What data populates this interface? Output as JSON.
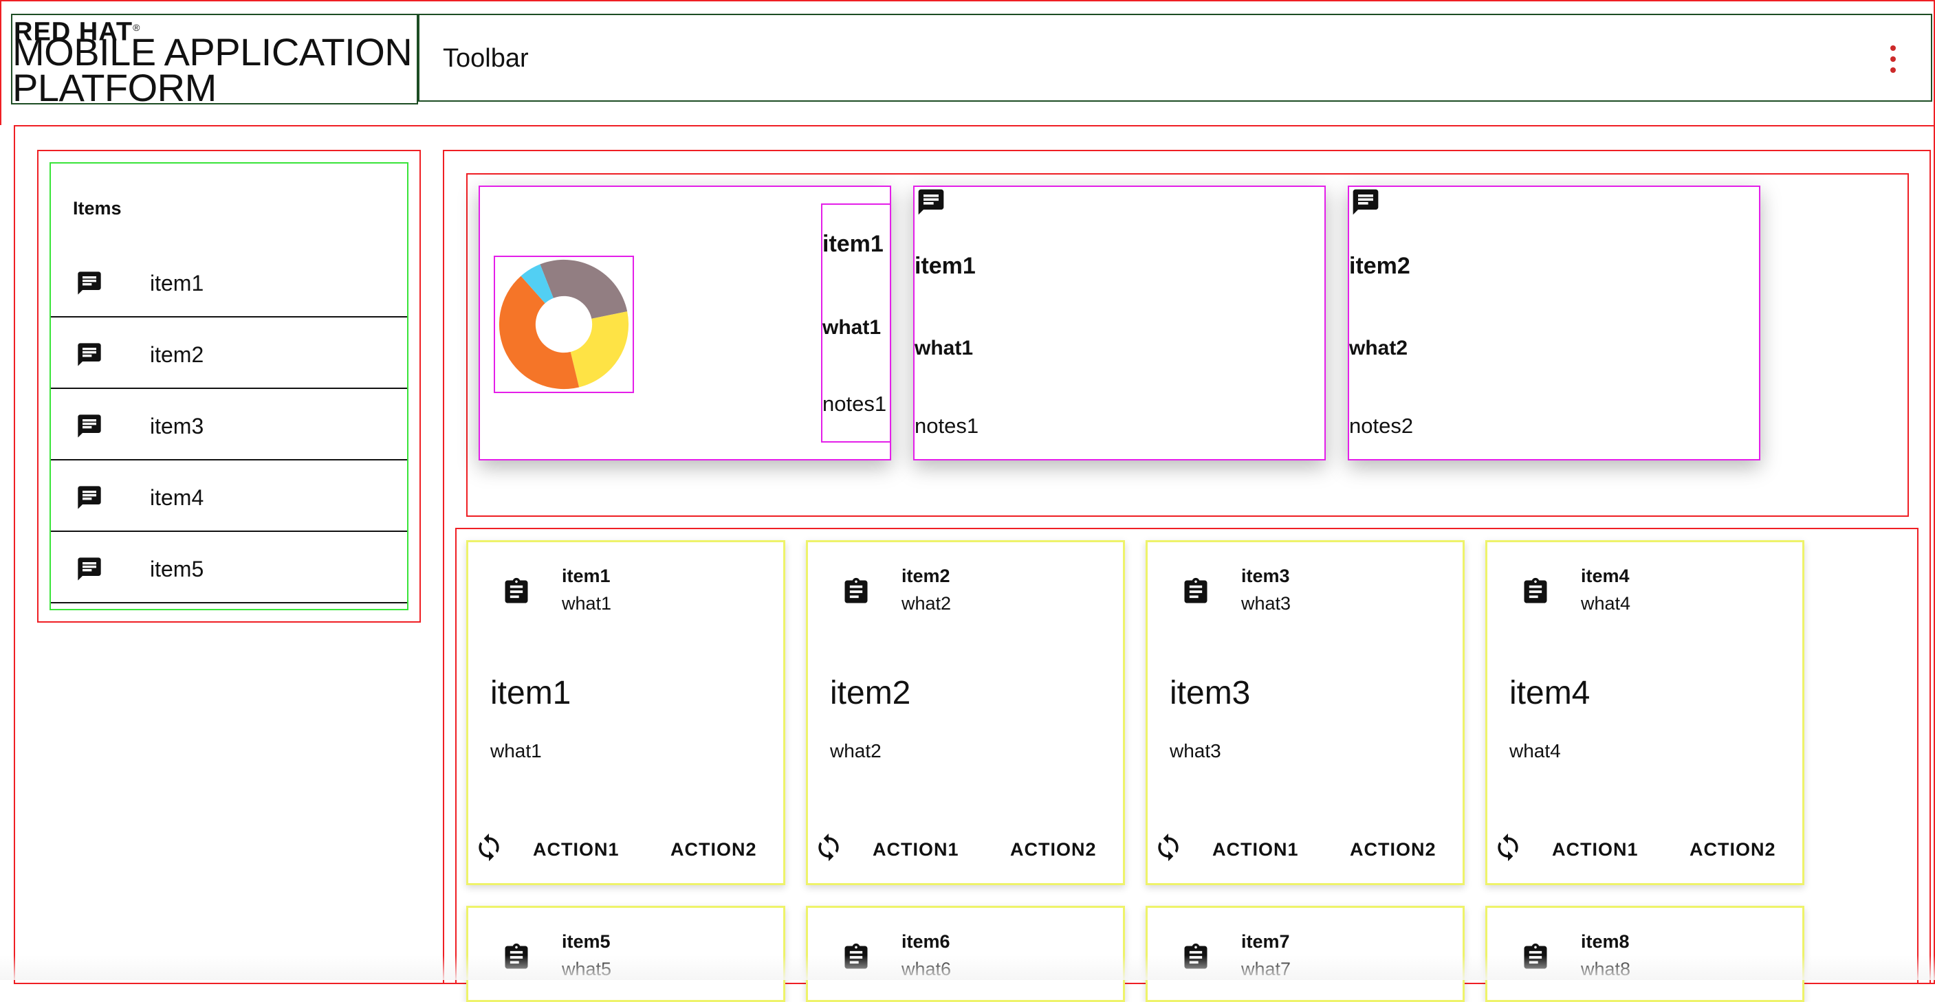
{
  "header": {
    "brand_small": "RED HAT",
    "brand_registered": "®",
    "brand_line1": "MOBILE APPLICATION",
    "brand_line2": "PLATFORM",
    "toolbar_title": "Toolbar",
    "kebab_icon": "more-vert-icon",
    "accent_color": "#cc2a2a"
  },
  "sidebar": {
    "heading": "Items",
    "item_icon": "message-icon",
    "items": [
      {
        "label": "item1"
      },
      {
        "label": "item2"
      },
      {
        "label": "item3"
      },
      {
        "label": "item4"
      },
      {
        "label": "item5"
      }
    ]
  },
  "chart_card": {
    "title": "item1",
    "what": "what1",
    "notes": "notes1"
  },
  "chart_data": {
    "type": "pie",
    "donut": true,
    "title": "",
    "categories": [
      "",
      "",
      "",
      ""
    ],
    "values": [
      25,
      22,
      38,
      5
    ],
    "colors": [
      "#927e82",
      "#fee345",
      "#f57528",
      "#52cff3"
    ]
  },
  "message_cards": [
    {
      "title": "item1",
      "what": "what1",
      "notes": "notes1",
      "icon": "message-icon"
    },
    {
      "title": "item2",
      "what": "what2",
      "notes": "notes2",
      "icon": "message-icon"
    }
  ],
  "grid_cards": [
    {
      "title": "item1",
      "subtitle": "what1",
      "heading": "item1",
      "text": "what1",
      "action1": "ACTION1",
      "action2": "ACTION2"
    },
    {
      "title": "item2",
      "subtitle": "what2",
      "heading": "item2",
      "text": "what2",
      "action1": "ACTION1",
      "action2": "ACTION2"
    },
    {
      "title": "item3",
      "subtitle": "what3",
      "heading": "item3",
      "text": "what3",
      "action1": "ACTION1",
      "action2": "ACTION2"
    },
    {
      "title": "item4",
      "subtitle": "what4",
      "heading": "item4",
      "text": "what4",
      "action1": "ACTION1",
      "action2": "ACTION2"
    },
    {
      "title": "item5",
      "subtitle": "what5"
    },
    {
      "title": "item6",
      "subtitle": "what6"
    },
    {
      "title": "item7",
      "subtitle": "what7"
    },
    {
      "title": "item8",
      "subtitle": "what8"
    }
  ],
  "icons": {
    "grid_card_icon": "clipboard-icon",
    "refresh_icon": "refresh-icon"
  },
  "colors": {
    "outline_red": "#ef1f24",
    "outline_green": "#39e439",
    "outline_magenta": "#e41fe9",
    "outline_yellow": "#eef36a",
    "outline_dark_green": "#1d4d24"
  }
}
